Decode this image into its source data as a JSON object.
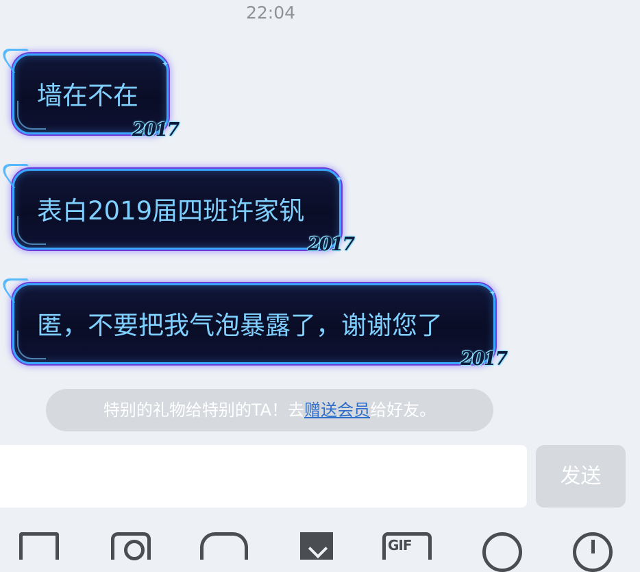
{
  "time": "22:04",
  "messages": [
    {
      "text": "墙在不在",
      "tag": "2017"
    },
    {
      "text": "表白2019届四班许家钒",
      "tag": "2017"
    },
    {
      "text": "匿，不要把我气泡暴露了，谢谢您了",
      "tag": "2017"
    }
  ],
  "notice": {
    "prefix": "特别的礼物给特别的TA！去",
    "link": "赠送会员",
    "suffix": "给好友。"
  },
  "input": {
    "value": ""
  },
  "send_label": "发送",
  "toolbar": {
    "gif_label": "GIF",
    "icons": [
      "image-icon",
      "camera-icon",
      "red-packet-icon",
      "envelope-icon",
      "gif-icon",
      "emoji-icon",
      "plus-icon"
    ]
  },
  "colors": {
    "bubble_bg": "#0a0d26",
    "bubble_border": "#3aa6ff",
    "bubble_text": "#7fd0ff",
    "link": "#2f6ec8",
    "background": "#edf1f5"
  }
}
